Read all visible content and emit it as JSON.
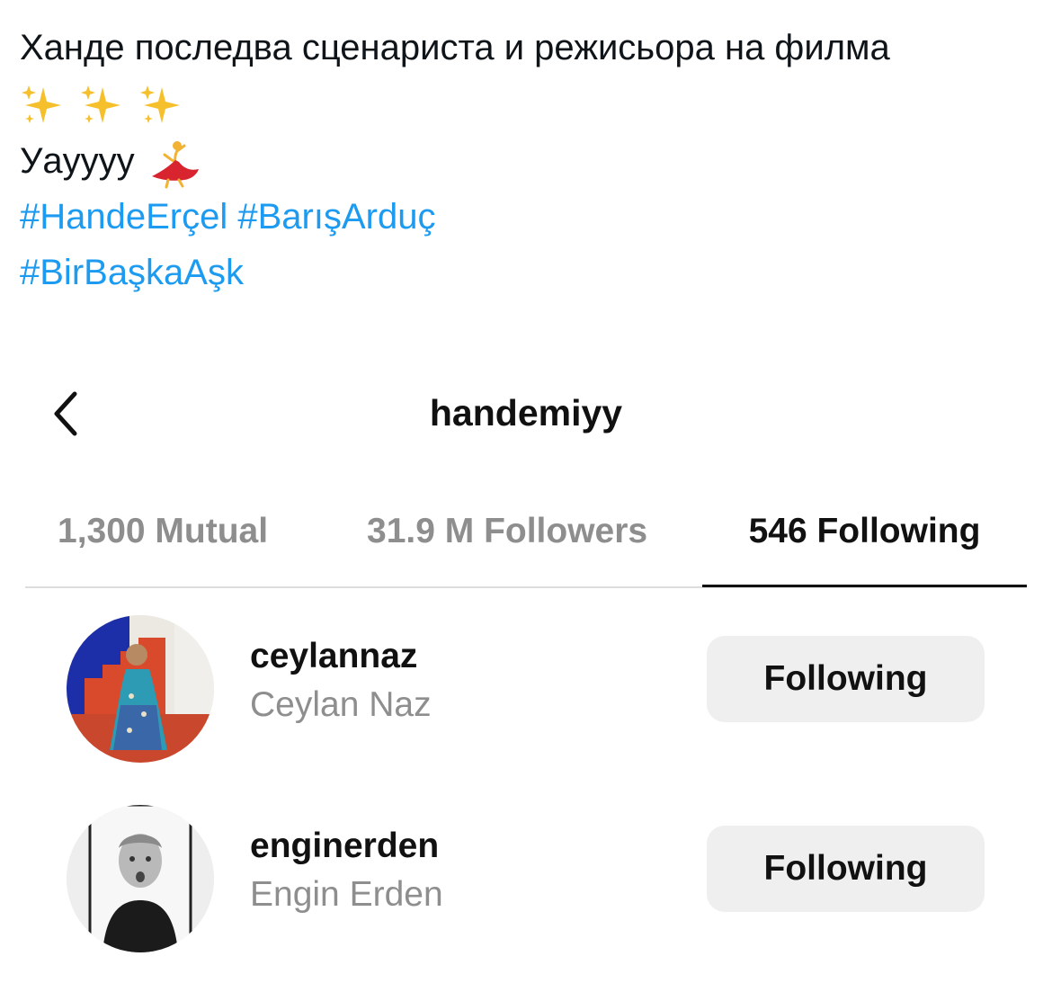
{
  "tweet": {
    "line1": "Ханде последва сценариста и режисьора на филма",
    "sparkle_icons": [
      "sparkles-icon",
      "sparkles-icon",
      "sparkles-icon"
    ],
    "line3": "Уаyyyy",
    "dancer_icon": "dancer-icon",
    "hashtags": [
      "#HandeErçel",
      "#BarışArduç",
      "#BirBaşkaAşk"
    ],
    "hashtag_color": "#1d9bf0"
  },
  "profile": {
    "back_icon": "chevron-left-icon",
    "username": "handemiyy"
  },
  "tabs": [
    {
      "label": "1,300 Mutual",
      "active": false
    },
    {
      "label": "31.9 M Followers",
      "active": false
    },
    {
      "label": "546 Following",
      "active": true
    }
  ],
  "accounts": [
    {
      "username": "ceylannaz",
      "full_name": "Ceylan Naz",
      "button": "Following"
    },
    {
      "username": "enginerden",
      "full_name": "Engin Erden",
      "button": "Following"
    }
  ],
  "colors": {
    "button_bg": "#efefef",
    "secondary_text": "#8e8e8e",
    "primary_text": "#111111"
  }
}
